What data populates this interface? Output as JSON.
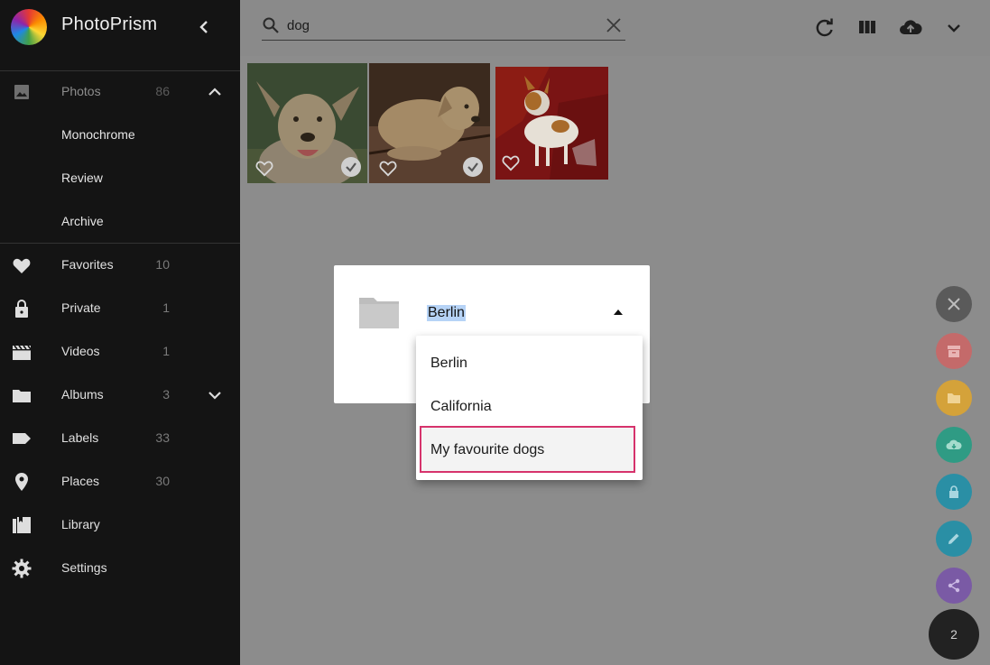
{
  "app": {
    "title": "PhotoPrism"
  },
  "sidebar": {
    "items": [
      {
        "label": "Photos",
        "count": "86"
      },
      {
        "label": "Monochrome"
      },
      {
        "label": "Review"
      },
      {
        "label": "Archive"
      },
      {
        "label": "Favorites",
        "count": "10"
      },
      {
        "label": "Private",
        "count": "1"
      },
      {
        "label": "Videos",
        "count": "1"
      },
      {
        "label": "Albums",
        "count": "3"
      },
      {
        "label": "Labels",
        "count": "33"
      },
      {
        "label": "Places",
        "count": "30"
      },
      {
        "label": "Library"
      },
      {
        "label": "Settings"
      }
    ]
  },
  "search": {
    "value": "dog"
  },
  "dialog": {
    "selected_album": "Berlin",
    "options": [
      "Berlin",
      "California",
      "My favourite dogs"
    ]
  },
  "selection": {
    "count": "2"
  },
  "colors": {
    "sidebar_bg": "#141414",
    "overlay": "#8c8c8c",
    "highlight_border": "#d6336c",
    "fab_close": "#5a5a5a",
    "fab_archive": "#c46a6a",
    "fab_album": "#d4a23a",
    "fab_download": "#2f9b84",
    "fab_private": "#2a8fa5",
    "fab_edit": "#2a8fa5",
    "fab_share": "#7a5aa5"
  }
}
